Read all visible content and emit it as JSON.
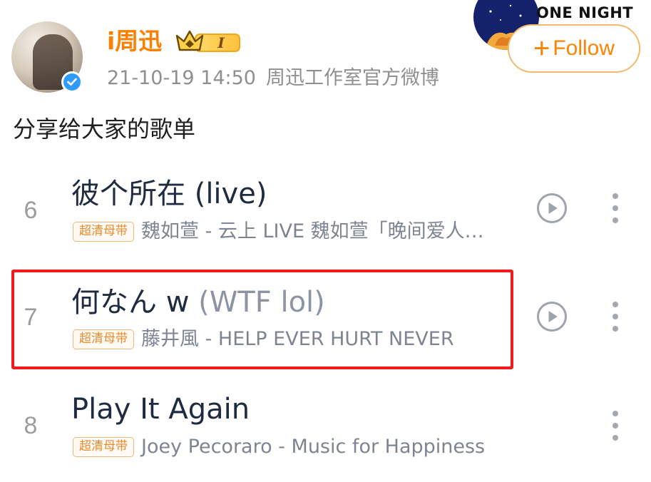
{
  "post": {
    "username": "i周迅",
    "vip_level": "I",
    "timestamp": "21-10-19 14:50",
    "source": "周迅工作室官方微博",
    "text": "分享给大家的歌单"
  },
  "brand": {
    "name": "ONE NIGHT"
  },
  "follow_button": {
    "plus": "+",
    "label": "Follow"
  },
  "playlist": {
    "quality_tag": "超清母带",
    "songs": [
      {
        "index": "6",
        "title": "彼个所在 (live)",
        "alias": "",
        "subtitle": "魏如萱 - 云上 LIVE 魏如萱「晚间爱人…",
        "has_play": true
      },
      {
        "index": "7",
        "title": "何なん w",
        "alias": " (WTF lol)",
        "subtitle": "藤井風 - HELP EVER HURT NEVER",
        "has_play": true,
        "highlighted": true
      },
      {
        "index": "8",
        "title": "Play It Again",
        "alias": "",
        "subtitle": "Joey Pecoraro - Music for Happiness",
        "has_play": false
      }
    ]
  },
  "colors": {
    "username": "#ff7f00",
    "follow_border": "#f3b96c",
    "follow_text": "#ff8200",
    "highlight": "#f01b1b",
    "verified": "#2f9bff",
    "quality_tag": "#ec8a2b"
  },
  "icons": {
    "verified": "verified-check-icon",
    "vip": "crown-icon",
    "play": "play-circle-icon",
    "more": "more-vertical-icon"
  }
}
